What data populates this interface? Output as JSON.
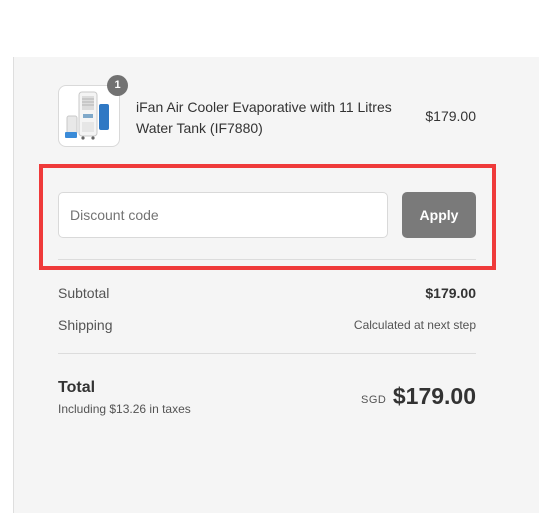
{
  "order_summary": {
    "item": {
      "quantity": "1",
      "name": "iFan Air Cooler Evaporative with 11 Litres Water Tank (IF7880)",
      "price": "$179.00",
      "thumbnail_icon": "air-cooler-product-image"
    },
    "discount": {
      "placeholder": "Discount code",
      "value": "",
      "apply_label": "Apply"
    },
    "subtotal": {
      "label": "Subtotal",
      "value": "$179.00"
    },
    "shipping": {
      "label": "Shipping",
      "value": "Calculated at next step"
    },
    "total": {
      "label": "Total",
      "tax_note": "Including $13.26 in taxes",
      "currency": "SGD",
      "amount": "$179.00"
    }
  },
  "colors": {
    "panel_background": "#f5f5f5",
    "apply_button": "#7a7a7a",
    "highlight_box": "#ef3a3a",
    "quantity_badge": "#727272"
  }
}
